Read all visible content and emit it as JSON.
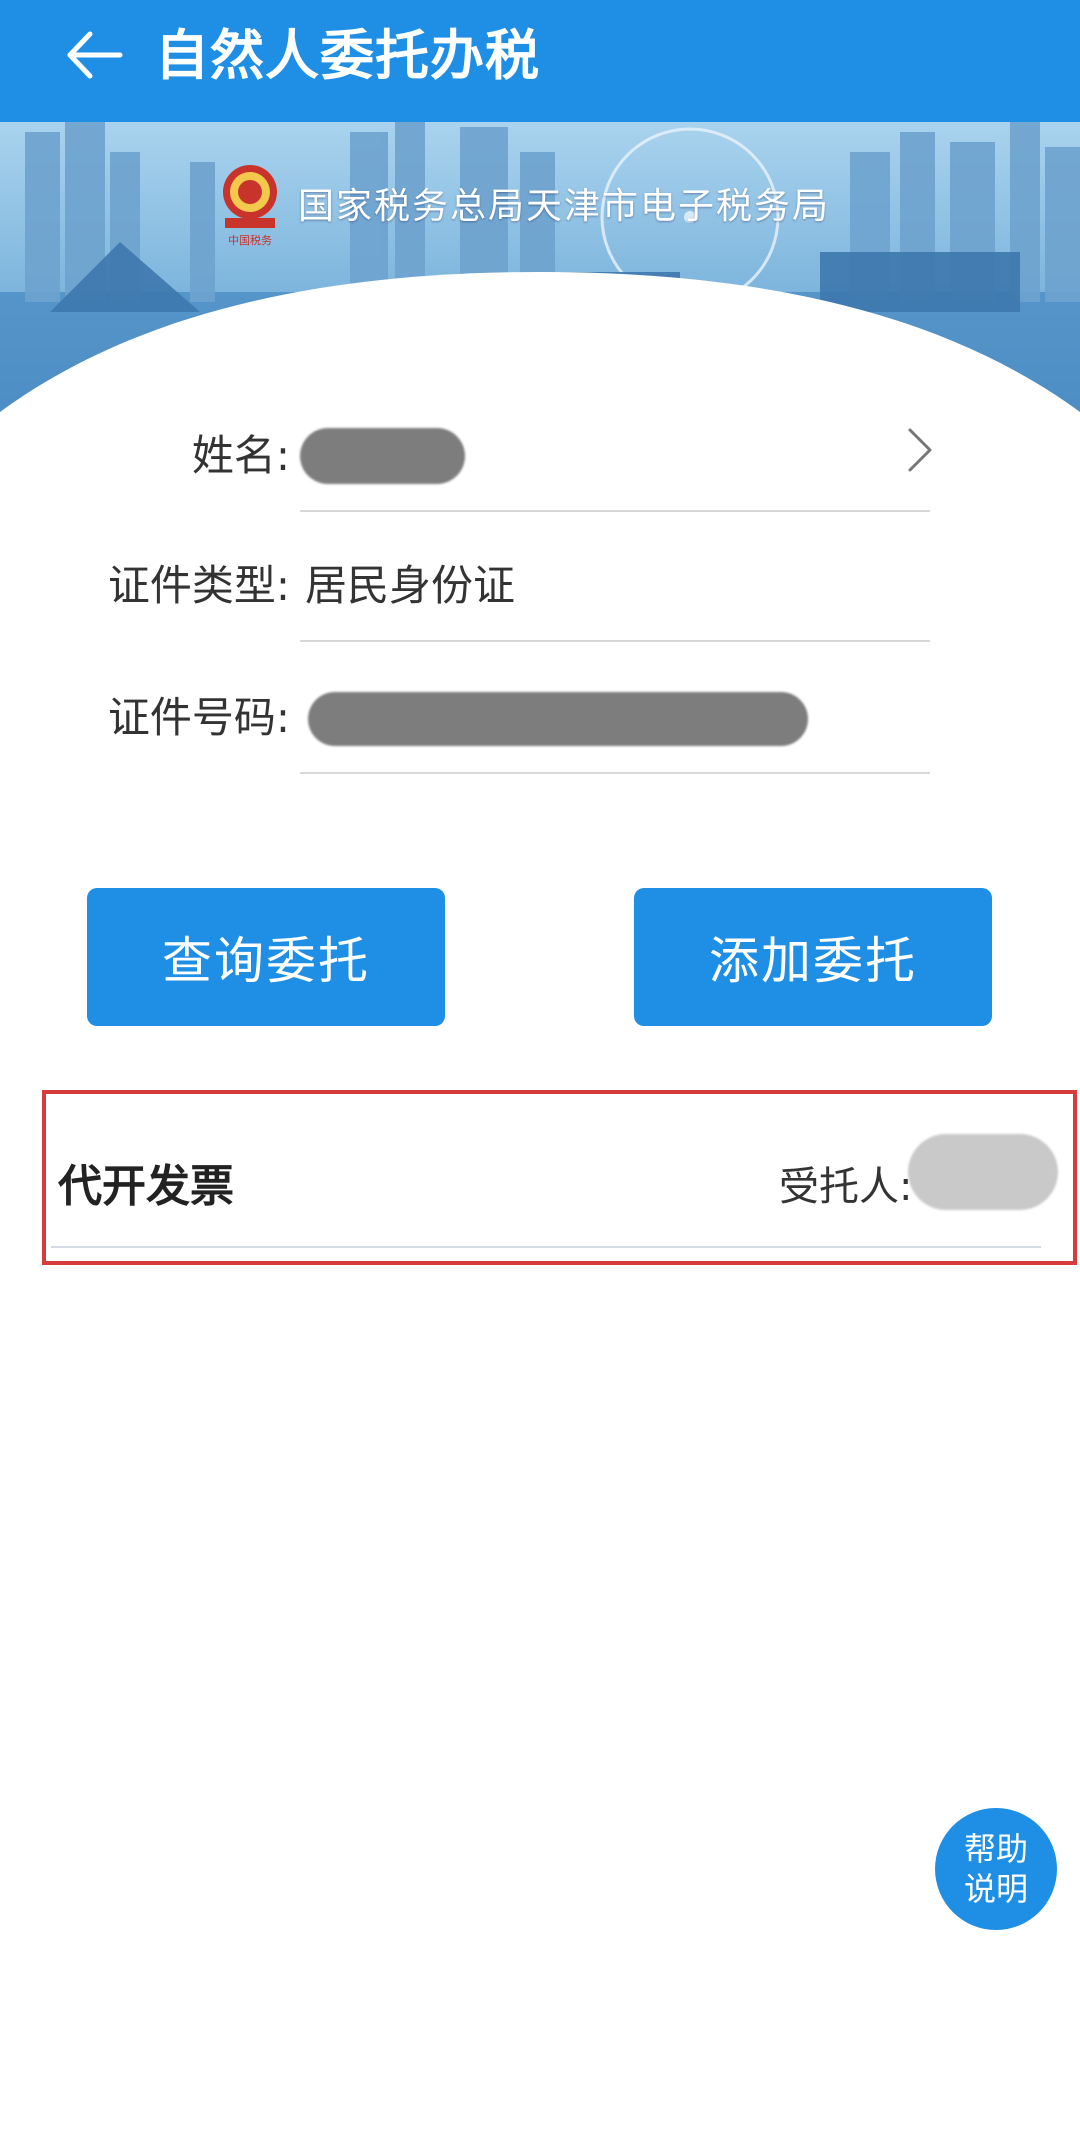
{
  "appbar": {
    "title": "自然人委托办税",
    "back_icon": "back-arrow-icon"
  },
  "banner": {
    "bureau_name": "国家税务总局天津市电子税务局",
    "emblem_icon": "tax-emblem-icon"
  },
  "form": {
    "name_label": "姓名:",
    "name_value": "",
    "id_type_label": "证件类型:",
    "id_type_value": "居民身份证",
    "id_number_label": "证件号码:",
    "id_number_value": ""
  },
  "buttons": {
    "query_label": "查询委托",
    "add_label": "添加委托"
  },
  "record": {
    "title": "代开发票",
    "trustee_label": "受托人:",
    "trustee_value": ""
  },
  "help": {
    "line1": "帮助",
    "line2": "说明"
  },
  "colors": {
    "primary": "#1f8fe6",
    "highlight_border": "#d63c3c"
  }
}
